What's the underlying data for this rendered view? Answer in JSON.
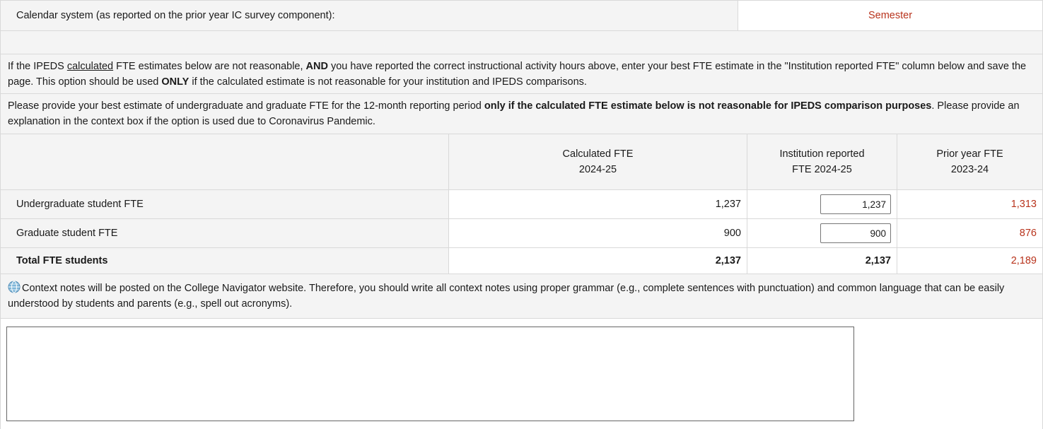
{
  "calendar": {
    "label": "Calendar system (as reported on the prior year IC survey component):",
    "value": "Semester"
  },
  "instructions": {
    "p1_a": "If the IPEDS ",
    "p1_u": "calculated",
    "p1_b": " FTE estimates below are not reasonable, ",
    "p1_and": "AND",
    "p1_c": " you have reported the correct instructional activity hours above, enter your best FTE estimate in the \"Institution reported FTE\" column below and save the page. This option should be used ",
    "p1_only": "ONLY",
    "p1_d": " if the calculated estimate is not reasonable for your institution and IPEDS comparisons.",
    "p2_a": "Please provide your best estimate of undergraduate and graduate FTE for the 12-month reporting period ",
    "p2_bold": "only if the calculated FTE estimate below is not reasonable for IPEDS comparison purposes",
    "p2_b": ". Please provide an explanation in the context box if the option is used due to Coronavirus Pandemic."
  },
  "table": {
    "headers": {
      "calculated_l1": "Calculated FTE",
      "calculated_l2": "2024-25",
      "reported_l1": "Institution reported",
      "reported_l2": "FTE 2024-25",
      "prior_l1": "Prior year FTE",
      "prior_l2": "2023-24"
    },
    "rows": [
      {
        "label": "Undergraduate student FTE",
        "calculated": "1,237",
        "reported": "1,237",
        "prior": "1,313"
      },
      {
        "label": "Graduate student FTE",
        "calculated": "900",
        "reported": "900",
        "prior": "876"
      }
    ],
    "total": {
      "label": "Total FTE students",
      "calculated": "2,137",
      "reported": "2,137",
      "prior": "2,189"
    }
  },
  "context": {
    "note": "Context notes will be posted on the College Navigator website. Therefore, you should write all context notes using proper grammar (e.g., complete sentences with punctuation) and common language that can be easily understood by students and parents (e.g., spell out acronyms).",
    "textarea_value": ""
  },
  "colors": {
    "accent_red": "#b8331c",
    "row_gray": "#f4f4f4",
    "border": "#d9d9d9"
  },
  "icons": {
    "context_icon": "globe-icon"
  }
}
